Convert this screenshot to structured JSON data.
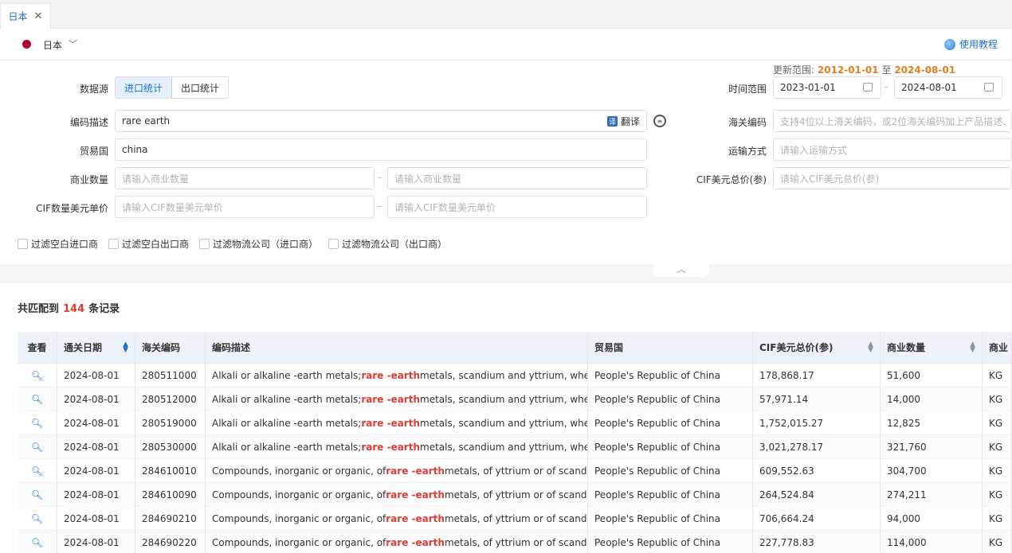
{
  "tab": {
    "label": "日本",
    "close": "✕"
  },
  "country": {
    "name": "日本",
    "help": "使用教程"
  },
  "update": {
    "prefix": "更新范围:",
    "from": "2012-01-01",
    "sep": "至",
    "to": "2024-08-01"
  },
  "form": {
    "datasource_label": "数据源",
    "import_label": "进口统计",
    "export_label": "出口统计",
    "time_label": "时间范围",
    "time_from": "2023-01-01",
    "time_to": "2024-08-01",
    "desc_label": "编码描述",
    "desc_value": "rare earth",
    "translate": "翻译",
    "hs_label": "海关编码",
    "hs_placeholder": "支持4位以上海关编码，或2位海关编码加上产品描述、",
    "partner_label": "贸易国",
    "partner_value": "china",
    "transport_label": "运输方式",
    "transport_placeholder": "请输入运输方式",
    "qty_label": "商业数量",
    "qty_placeholder": "请输入商业数量",
    "cif_total_label": "CIF美元总价(参)",
    "cif_total_placeholder": "请输入CIF美元总价(参)",
    "cif_unit_label": "CIF数量美元单价",
    "cif_unit_placeholder": "请输入CIF数量美元单价",
    "filters": [
      "过滤空白进口商",
      "过滤空白出口商",
      "过滤物流公司（进口商）",
      "过滤物流公司（出口商）"
    ]
  },
  "results": {
    "prefix": "共匹配到",
    "count": "144",
    "suffix": "条记录"
  },
  "table": {
    "headers": [
      "查看",
      "通关日期",
      "海关编码",
      "编码描述",
      "贸易国",
      "CIF美元总价(参)",
      "商业数量",
      "商业"
    ],
    "rows": [
      {
        "date": "2024-08-01",
        "hs": "280511000",
        "d1": "Alkali or alkaline -earth metals; ",
        "hl": "rare -earth",
        "d2": " metals, scandium and yttrium, wheth",
        "country": "People's Republic of China",
        "cif": "178,868.17",
        "qty": "51,600",
        "unit": "KG"
      },
      {
        "date": "2024-08-01",
        "hs": "280512000",
        "d1": "Alkali or alkaline -earth metals; ",
        "hl": "rare -earth",
        "d2": " metals, scandium and yttrium, wheth",
        "country": "People's Republic of China",
        "cif": "57,971.14",
        "qty": "14,000",
        "unit": "KG"
      },
      {
        "date": "2024-08-01",
        "hs": "280519000",
        "d1": "Alkali or alkaline -earth metals; ",
        "hl": "rare -earth",
        "d2": " metals, scandium and yttrium, wheth",
        "country": "People's Republic of China",
        "cif": "1,752,015.27",
        "qty": "12,825",
        "unit": "KG"
      },
      {
        "date": "2024-08-01",
        "hs": "280530000",
        "d1": "Alkali or alkaline -earth metals; ",
        "hl": "rare -earth",
        "d2": " metals, scandium and yttrium, wheth",
        "country": "People's Republic of China",
        "cif": "3,021,278.17",
        "qty": "321,760",
        "unit": "KG"
      },
      {
        "date": "2024-08-01",
        "hs": "284610010",
        "d1": "Compounds, inorganic or organic, of ",
        "hl": "rare -earth",
        "d2": " metals, of yttrium or of scandiu",
        "country": "People's Republic of China",
        "cif": "609,552.63",
        "qty": "304,700",
        "unit": "KG"
      },
      {
        "date": "2024-08-01",
        "hs": "284610090",
        "d1": "Compounds, inorganic or organic, of ",
        "hl": "rare -earth",
        "d2": " metals, of yttrium or of scandiu",
        "country": "People's Republic of China",
        "cif": "264,524.84",
        "qty": "274,211",
        "unit": "KG"
      },
      {
        "date": "2024-08-01",
        "hs": "284690210",
        "d1": "Compounds, inorganic or organic, of ",
        "hl": "rare -earth",
        "d2": " metals, of yttrium or of scandiu",
        "country": "People's Republic of China",
        "cif": "706,664.24",
        "qty": "94,000",
        "unit": "KG"
      },
      {
        "date": "2024-08-01",
        "hs": "284690220",
        "d1": "Compounds, inorganic or organic, of ",
        "hl": "rare -earth",
        "d2": " metals, of yttrium or of scandiu",
        "country": "People's Republic of China",
        "cif": "227,778.83",
        "qty": "114,000",
        "unit": "KG"
      }
    ]
  }
}
